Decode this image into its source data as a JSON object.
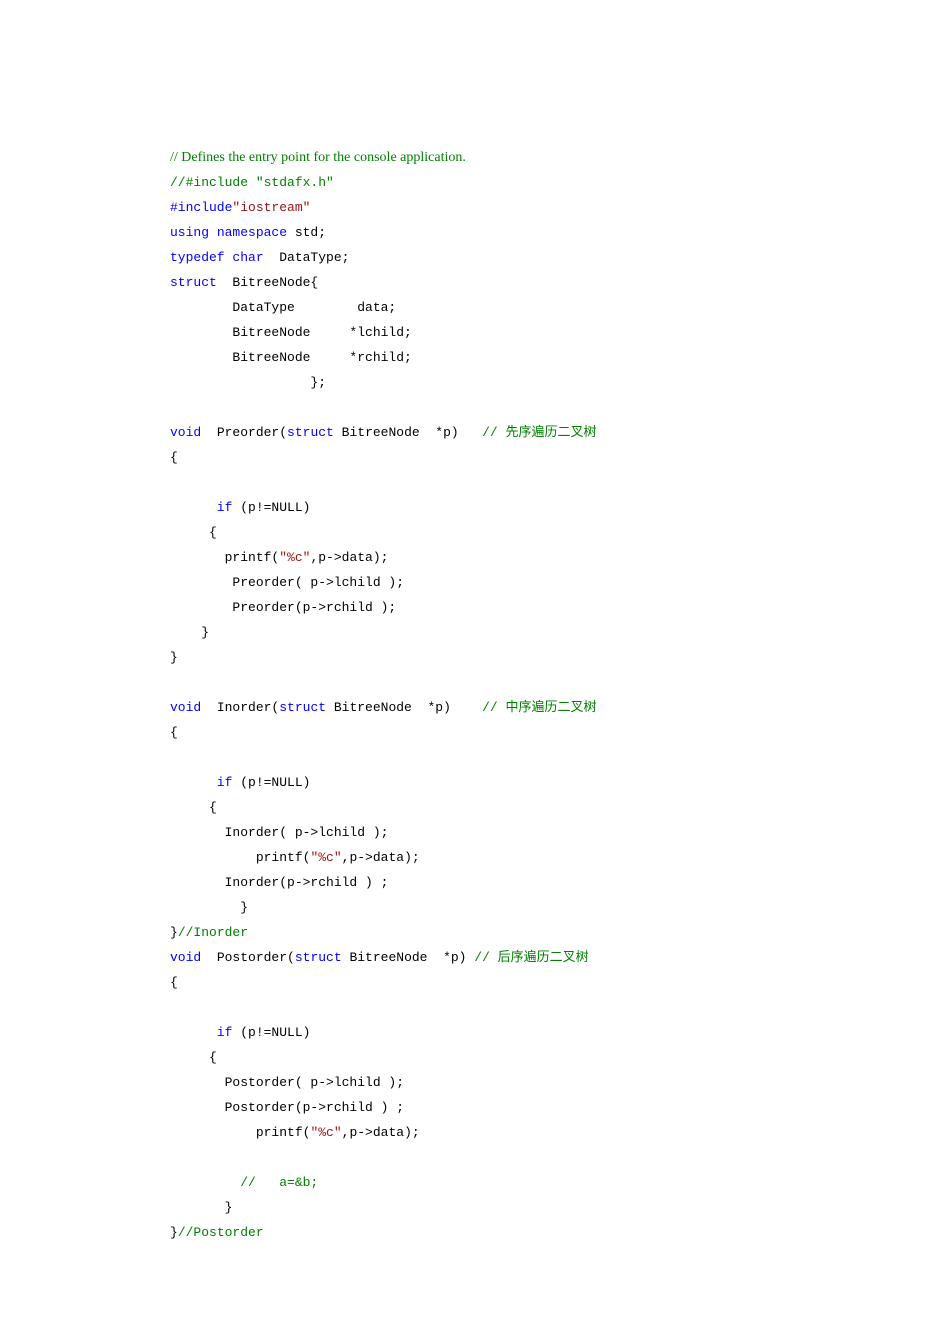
{
  "code": {
    "l01_cmt": "// Defines the entry point for the console application.",
    "l02_a": "//#include ",
    "l02_b": "\"stdafx.h\"",
    "l03_a": "#include",
    "l03_b": "\"iostream\"",
    "l04_a": "using",
    "l04_b": " namespace",
    "l04_c": " std;",
    "l05_a": "typedef",
    "l05_b": " char",
    "l05_c": "  DataType;",
    "l06_a": "struct",
    "l06_b": "  BitreeNode{",
    "l07": "        DataType        data;",
    "l08": "        BitreeNode     *lchild;",
    "l09": "        BitreeNode     *rchild;",
    "l10": "                  };",
    "l11": "",
    "l12_a": "void",
    "l12_b": "  Preorder(",
    "l12_c": "struct",
    "l12_d": " BitreeNode  *p)   ",
    "l12_e": "// 先序遍历二叉树",
    "l13": "{",
    "l14": "",
    "l15_a": "      if",
    "l15_b": " (p!=NULL)",
    "l16": "     {",
    "l17_a": "       printf(",
    "l17_b": "\"%c\"",
    "l17_c": ",p->data);",
    "l18": "        Preorder( p->lchild );",
    "l19": "        Preorder(p->rchild );",
    "l20": "    }",
    "l21": "}",
    "l22": "",
    "l23_a": "void",
    "l23_b": "  Inorder(",
    "l23_c": "struct",
    "l23_d": " BitreeNode  *p)    ",
    "l23_e": "// 中序遍历二叉树",
    "l24": "{",
    "l25": "",
    "l26_a": "      if",
    "l26_b": " (p!=NULL)",
    "l27": "     {",
    "l28": "       Inorder( p->lchild );",
    "l29_a": "           printf(",
    "l29_b": "\"%c\"",
    "l29_c": ",p->data);",
    "l30": "       Inorder(p->rchild ) ;",
    "l31": "         }",
    "l32_a": "}",
    "l32_b": "//Inorder",
    "l33_a": "void",
    "l33_b": "  Postorder(",
    "l33_c": "struct",
    "l33_d": " BitreeNode  *p) ",
    "l33_e": "// 后序遍历二叉树",
    "l34": "{",
    "l35": "",
    "l36_a": "      if",
    "l36_b": " (p!=NULL)",
    "l37": "     {",
    "l38": "       Postorder( p->lchild );",
    "l39": "       Postorder(p->rchild ) ;",
    "l40_a": "           printf(",
    "l40_b": "\"%c\"",
    "l40_c": ",p->data);",
    "l41": "",
    "l42": "         //   a=&b;",
    "l43": "       }",
    "l44_a": "}",
    "l44_b": "//Postorder"
  }
}
